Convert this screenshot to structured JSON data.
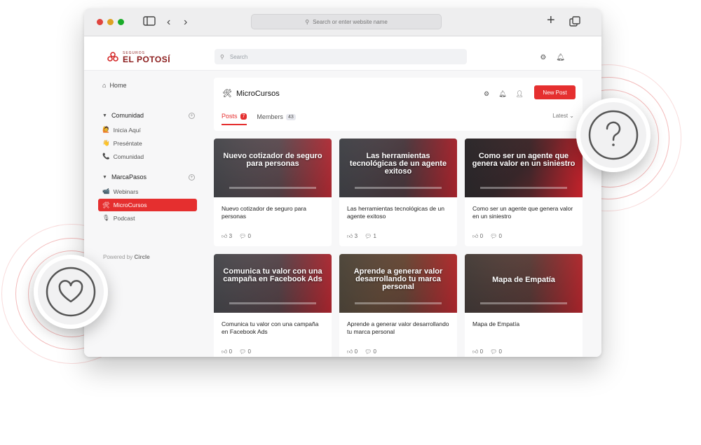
{
  "browser": {
    "address_placeholder": "Search or enter website name",
    "dot_colors": [
      "#e0443e",
      "#dea123",
      "#1aab29"
    ]
  },
  "brand": {
    "logo_small": "SEGUROS",
    "logo_main": "EL POTOSÍ",
    "accent": "#e52f2f"
  },
  "topbar": {
    "search_placeholder": "Search"
  },
  "sidebar": {
    "home": "Home",
    "groups": [
      {
        "label": "Comunidad",
        "items": [
          {
            "icon": "🙋",
            "label": "Inicia Aquí"
          },
          {
            "icon": "👋",
            "label": "Preséntate"
          },
          {
            "icon": "📞",
            "label": "Comunidad"
          }
        ]
      },
      {
        "label": "MarcaPasos",
        "items": [
          {
            "icon": "📹",
            "label": "Webinars"
          },
          {
            "icon": "🛠",
            "label": "MicroCursos"
          },
          {
            "icon": "🎙",
            "label": "Podcast"
          }
        ]
      }
    ],
    "powered_prefix": "Powered by",
    "powered_brand": "Circle"
  },
  "space": {
    "icon": "🛠",
    "title": "MicroCursos",
    "new_post": "New Post",
    "tabs": [
      {
        "label": "Posts",
        "count": "7"
      },
      {
        "label": "Members",
        "count": "43"
      }
    ],
    "sort": "Latest"
  },
  "posts": [
    {
      "headline": "Nuevo cotizador de seguro para personas",
      "title": "Nuevo cotizador de seguro para personas",
      "likes": "3",
      "comments": "0"
    },
    {
      "headline": "Las herramientas tecnológicas de un agente exitoso",
      "title": "Las herramientas tecnológicas de un agente exitoso",
      "likes": "3",
      "comments": "1"
    },
    {
      "headline": "Como ser un agente que genera valor en un siniestro",
      "title": "Como ser un agente que genera valor en un siniestro",
      "likes": "0",
      "comments": "0"
    },
    {
      "headline": "Comunica tu valor con una campaña en Facebook Ads",
      "title": "Comunica tu valor con una campaña en Facebook Ads",
      "likes": "0",
      "comments": "0"
    },
    {
      "headline": "Aprende a generar valor desarrollando tu marca personal",
      "title": "Aprende a generar valor desarrollando tu marca personal",
      "likes": "0",
      "comments": "0"
    },
    {
      "headline": "Mapa de Empatía",
      "title": "Mapa de Empatía",
      "likes": "0",
      "comments": "0"
    }
  ]
}
